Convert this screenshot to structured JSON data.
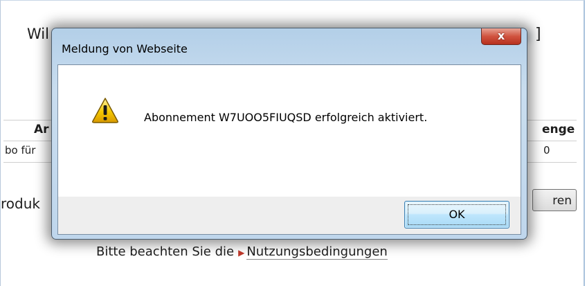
{
  "background_page": {
    "welcome_text": "Wil",
    "welcome_bracket": "]",
    "table": {
      "header_left": "Ar",
      "header_right": "enge",
      "row_left": "bo für",
      "row_right": "0"
    },
    "product_text": "roduk",
    "button_label": "ren",
    "terms_prefix": "Bitte beachten Sie die",
    "terms_link": "Nutzungsbedingungen"
  },
  "dialog": {
    "title": "Meldung von Webseite",
    "close_label": "x",
    "message": "Abonnement W7UOO5FIUQSD erfolgreich aktiviert.",
    "icon": "warning-icon",
    "ok_label": "OK"
  },
  "colors": {
    "dialog_frame": "#bfd6ec",
    "close_button": "#d0533f",
    "ok_button": "#bee6fd",
    "warning": "#f2c200"
  }
}
